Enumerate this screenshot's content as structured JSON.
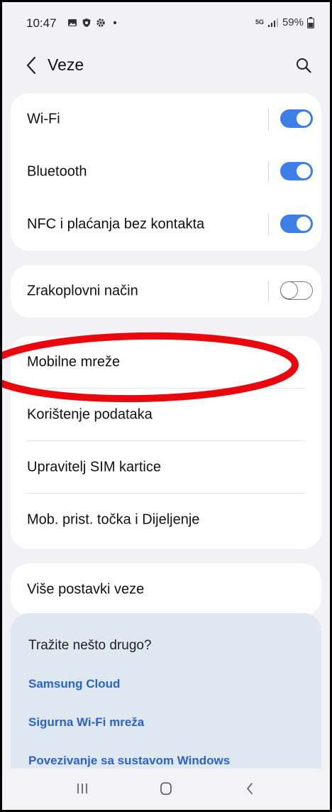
{
  "status_bar": {
    "time": "10:47",
    "battery": "59%",
    "network": "5G",
    "left_icons": [
      "gallery-icon",
      "shield-icon",
      "gear-icon",
      "dot-icon"
    ]
  },
  "header": {
    "title": "Veze"
  },
  "connections": [
    {
      "label": "Wi-Fi",
      "toggle": true
    },
    {
      "label": "Bluetooth",
      "toggle": true
    },
    {
      "label": "NFC i plaćanja bez kontakta",
      "toggle": true
    }
  ],
  "airplane": {
    "label": "Zrakoplovni način",
    "toggle": false
  },
  "network_items": [
    {
      "label": "Mobilne mreže"
    },
    {
      "label": "Korištenje podataka"
    },
    {
      "label": "Upravitelj SIM kartice"
    },
    {
      "label": "Mob. prist. točka i Dijeljenje"
    }
  ],
  "more": {
    "label": "Više postavki veze"
  },
  "suggestions": {
    "title": "Tražite nešto drugo?",
    "links": [
      "Samsung Cloud",
      "Sigurna Wi-Fi mreža",
      "Povezivanje sa sustavom Windows"
    ]
  },
  "colors": {
    "accent": "#3e7ee8",
    "link": "#2a63c9",
    "annotation": "#e8080e",
    "background": "#f2f2f4"
  }
}
